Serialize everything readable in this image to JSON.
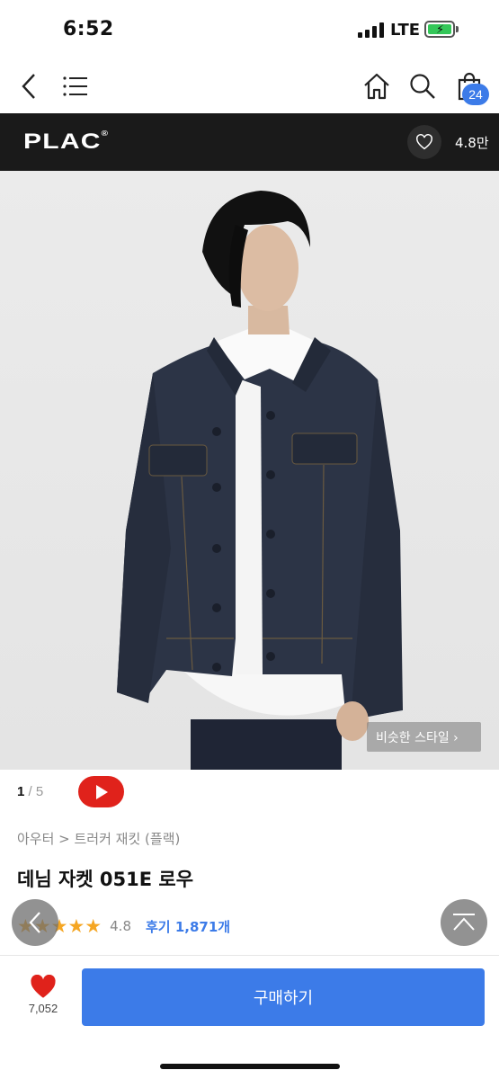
{
  "status_bar": {
    "time": "6:52",
    "network": "LTE"
  },
  "nav": {
    "cart_count": "24",
    "icons": [
      "back-icon",
      "menu-icon",
      "home-icon",
      "search-icon",
      "cart-icon"
    ]
  },
  "brand": {
    "name": "PLAC",
    "mark": "®",
    "likes": "4.8만"
  },
  "gallery": {
    "current": "1",
    "total": "/ 5",
    "similar_style_label": "비슷한 스타일 ›"
  },
  "product": {
    "breadcrumb": "아우터 > 트러커 재킷 (플랙)",
    "title": "데님 자켓 051E 로우",
    "stars": "★★★★★",
    "score": "4.8",
    "reviews": "후기 1,871개"
  },
  "bottom_bar": {
    "wish_count": "7,052",
    "buy_label": "구매하기"
  },
  "colors": {
    "accent": "#3c7be8",
    "brand_bar": "#1a1a1a",
    "star": "#f5a623",
    "wish": "#e0221b",
    "youtube": "#e0221b"
  }
}
